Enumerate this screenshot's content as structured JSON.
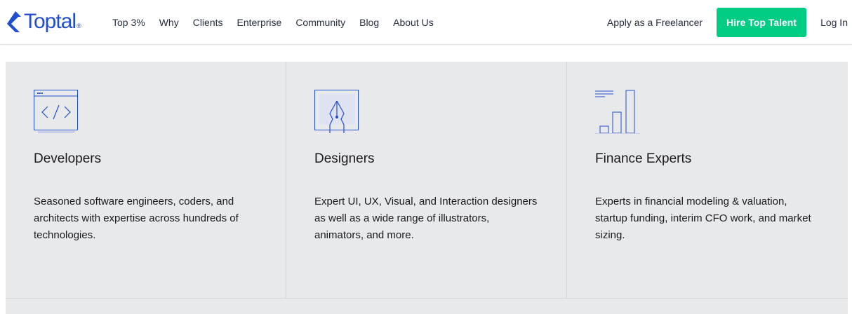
{
  "brand": {
    "name": "Toptal",
    "mark": "®",
    "color": "#204ecf",
    "icon": "toptal-logo-icon"
  },
  "nav": {
    "items": [
      {
        "label": "Top 3%"
      },
      {
        "label": "Why"
      },
      {
        "label": "Clients"
      },
      {
        "label": "Enterprise"
      },
      {
        "label": "Community"
      },
      {
        "label": "Blog"
      },
      {
        "label": "About Us"
      }
    ]
  },
  "actions": {
    "apply_label": "Apply as a Freelancer",
    "hire_label": "Hire Top Talent",
    "hire_color": "#00cc83",
    "login_label": "Log In"
  },
  "cards": [
    {
      "icon": "code-window-icon",
      "title": "Developers",
      "description": "Seasoned software engineers, coders, and architects with expertise across hundreds of technologies."
    },
    {
      "icon": "pen-nib-icon",
      "title": "Designers",
      "description": "Expert UI, UX, Visual, and Interaction designers as well as a wide range of illustrators, animators, and more."
    },
    {
      "icon": "bar-chart-icon",
      "title": "Finance Experts",
      "description": "Experts in financial modeling & valuation, startup funding, interim CFO work, and market sizing."
    }
  ],
  "colors": {
    "grid_background": "#e8e9eb",
    "icon_stroke": "#204ecf",
    "text": "#262d3d"
  }
}
